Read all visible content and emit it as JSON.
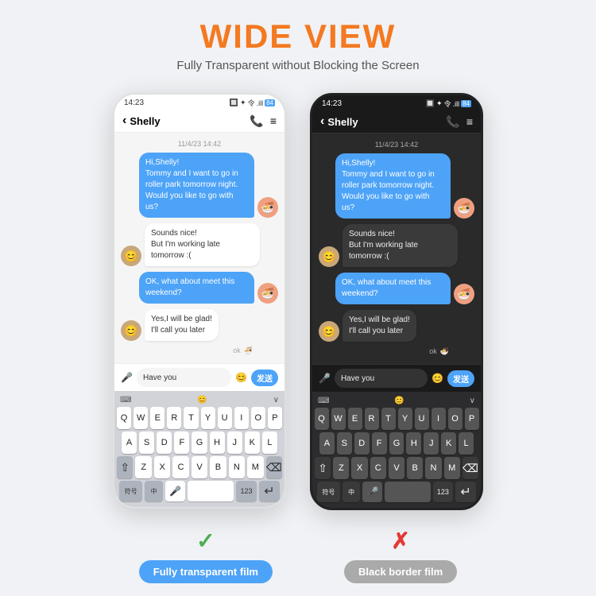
{
  "header": {
    "title": "WIDE VIEW",
    "subtitle": "Fully Transparent without Blocking the Screen"
  },
  "phone_left": {
    "status_time": "14:23",
    "status_icons": "🔲 ✦ 令 .ill 84",
    "contact": "Shelly",
    "date": "11/4/23 14:42",
    "messages": [
      {
        "type": "sent",
        "text": "Hi,Shelly!\nTommy and I want to go in roller park tomorrow night. Would you like to go with us?",
        "has_avatar": true
      },
      {
        "type": "recv",
        "text": "Sounds nice!\nBut I'm working late tomorrow :(",
        "has_avatar": true
      },
      {
        "type": "sent",
        "text": "OK, what about meet this weekend?",
        "has_avatar": true
      },
      {
        "type": "recv",
        "text": "Yes,I will be glad!\nI'll call you later",
        "has_avatar": true
      }
    ],
    "ok_label": "ok",
    "input_placeholder": "Have you",
    "send_label": "发送"
  },
  "phone_right": {
    "status_time": "14:23",
    "status_icons": "🔲 ✦ 令 .ill 84",
    "contact": "Shelly",
    "date": "11/4/23 14:42",
    "messages": [
      {
        "type": "sent",
        "text": "Hi,Shelly!\nTommy and I want to go in roller park tomorrow night. Would you like to go with us?",
        "has_avatar": true
      },
      {
        "type": "recv",
        "text": "Sounds nice!\nBut I'm working late tomorrow :(",
        "has_avatar": true
      },
      {
        "type": "sent",
        "text": "OK, what about meet this weekend?",
        "has_avatar": true
      },
      {
        "type": "recv",
        "text": "Yes,I will be glad!\nI'll call you later",
        "has_avatar": true
      }
    ],
    "ok_label": "ok",
    "input_placeholder": "Have you",
    "send_label": "发送"
  },
  "keyboard": {
    "rows": [
      [
        "Q",
        "W",
        "E",
        "R",
        "T",
        "Y",
        "U",
        "I",
        "O",
        "P"
      ],
      [
        "A",
        "S",
        "D",
        "F",
        "G",
        "H",
        "J",
        "K",
        "L"
      ],
      [
        "Z",
        "X",
        "C",
        "V",
        "B",
        "N",
        "M"
      ]
    ],
    "bottom": [
      "符号",
      "中",
      "mic",
      "123",
      "enter"
    ]
  },
  "labels": {
    "left_symbol": "✓",
    "left_text": "Fully transparent film",
    "right_symbol": "✗",
    "right_text": "Black border film"
  },
  "colors": {
    "title": "#f47920",
    "checkmark": "#4caf50",
    "crossmark": "#e53935",
    "bubble_sent": "#4da3f7",
    "label_left": "#4da3f7",
    "label_right": "#aaaaaa"
  }
}
